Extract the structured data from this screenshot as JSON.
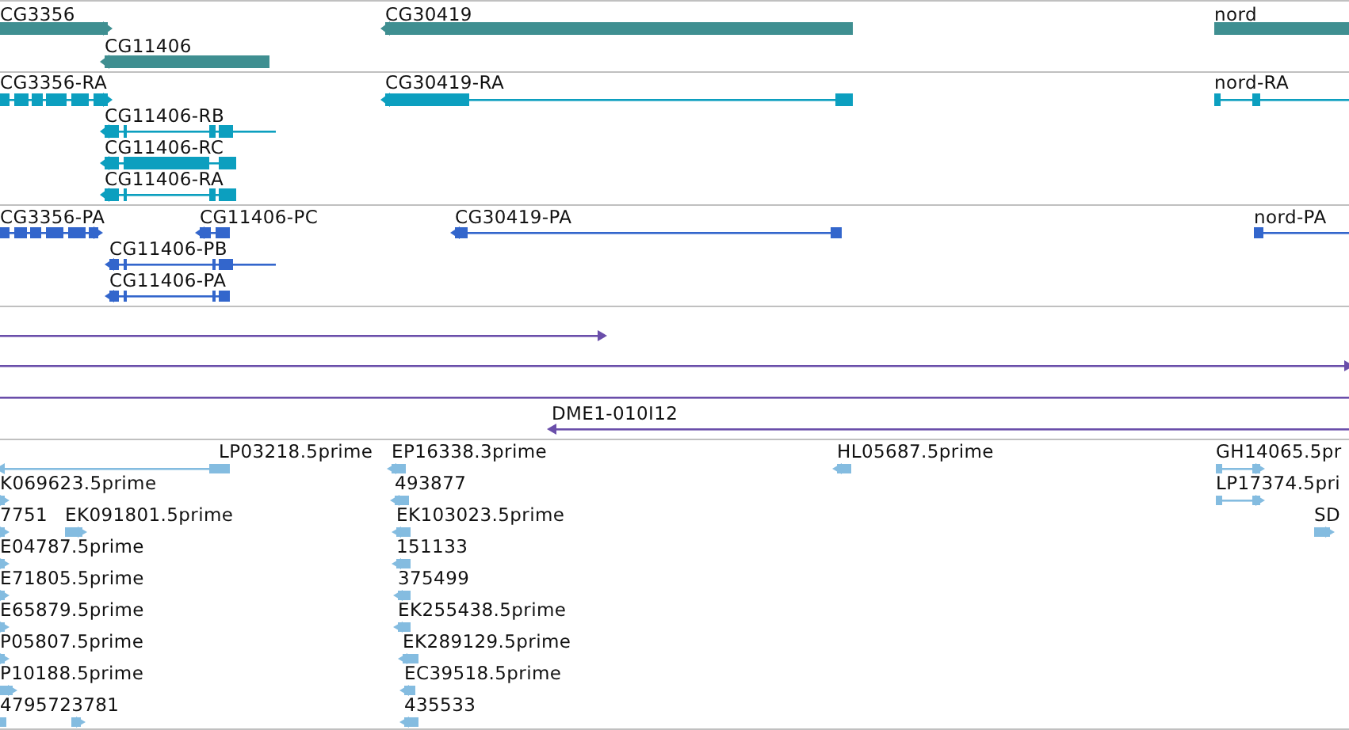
{
  "tracks": [
    {
      "kind": "gene",
      "features": [
        {
          "label": "CG3356",
          "reverse": false
        },
        {
          "label": "CG11406",
          "reverse": true
        },
        {
          "label": "CG30419",
          "reverse": true
        },
        {
          "label": "nord",
          "reverse": false
        }
      ]
    },
    {
      "kind": "transcript",
      "features": [
        {
          "label": "CG3356-RA",
          "reverse": false
        },
        {
          "label": "CG11406-RB",
          "reverse": true
        },
        {
          "label": "CG11406-RC",
          "reverse": true
        },
        {
          "label": "CG11406-RA",
          "reverse": true
        },
        {
          "label": "CG30419-RA",
          "reverse": true
        },
        {
          "label": "nord-RA",
          "reverse": false
        }
      ]
    },
    {
      "kind": "protein",
      "features": [
        {
          "label": "CG3356-PA",
          "reverse": false
        },
        {
          "label": "CG11406-PC",
          "reverse": true
        },
        {
          "label": "CG11406-PB",
          "reverse": true
        },
        {
          "label": "CG11406-PA",
          "reverse": true
        },
        {
          "label": "CG30419-PA",
          "reverse": true
        },
        {
          "label": "nord-PA",
          "reverse": false
        }
      ]
    },
    {
      "kind": "clone",
      "features": [
        {
          "reverse": false
        },
        {
          "reverse": false
        },
        {
          "reverse": false
        },
        {
          "label": "DME1-010I12",
          "reverse": true
        }
      ]
    },
    {
      "kind": "est",
      "features": [
        {
          "label": "LP03218.5prime",
          "reverse": true
        },
        {
          "label": "EP16338.3prime",
          "reverse": true
        },
        {
          "label": "HL05687.5prime",
          "reverse": true
        },
        {
          "label": "GH14065.5pr",
          "reverse": false
        },
        {
          "label": "K069623.5prime",
          "reverse": false
        },
        {
          "label": "493877",
          "reverse": true
        },
        {
          "label": "LP17374.5pri",
          "reverse": false
        },
        {
          "label": "7751",
          "reverse": false
        },
        {
          "label": "EK091801.5prime",
          "reverse": false
        },
        {
          "label": "EK103023.5prime",
          "reverse": true
        },
        {
          "label": "SD",
          "reverse": false
        },
        {
          "label": "E04787.5prime",
          "reverse": false
        },
        {
          "label": "151133",
          "reverse": true
        },
        {
          "label": "E71805.5prime",
          "reverse": false
        },
        {
          "label": "375499",
          "reverse": true
        },
        {
          "label": "E65879.5prime",
          "reverse": false
        },
        {
          "label": "EK255438.5prime",
          "reverse": true
        },
        {
          "label": "P05807.5prime",
          "reverse": false
        },
        {
          "label": "EK289129.5prime",
          "reverse": true
        },
        {
          "label": "P10188.5prime",
          "reverse": false
        },
        {
          "label": "EC39518.5prime",
          "reverse": true
        },
        {
          "label": "4795723781",
          "reverse": false
        },
        {
          "label": "435533",
          "reverse": true
        }
      ]
    }
  ]
}
